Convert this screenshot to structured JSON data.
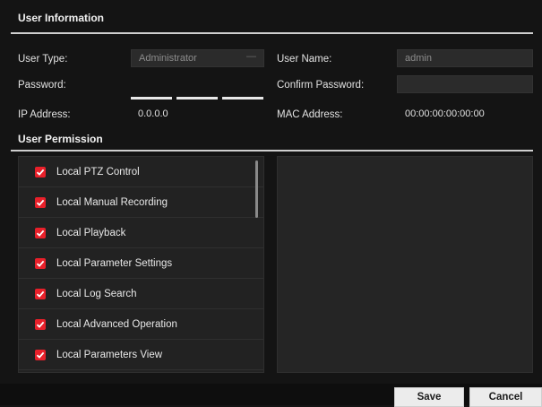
{
  "user_information": {
    "title": "User Information",
    "user_type": {
      "label": "User Type:",
      "value": "Administrator"
    },
    "user_name": {
      "label": "User Name:",
      "value": "admin"
    },
    "password": {
      "label": "Password:"
    },
    "confirm_password": {
      "label": "Confirm Password:"
    },
    "ip_address": {
      "label": "IP Address:",
      "value": "0.0.0.0"
    },
    "mac_address": {
      "label": "MAC Address:",
      "value": "00:00:00:00:00:00"
    }
  },
  "user_permission": {
    "title": "User Permission",
    "items": [
      {
        "label": "Local PTZ Control",
        "checked": true
      },
      {
        "label": "Local Manual Recording",
        "checked": true
      },
      {
        "label": "Local Playback",
        "checked": true
      },
      {
        "label": "Local Parameter Settings",
        "checked": true
      },
      {
        "label": "Local Log Search",
        "checked": true
      },
      {
        "label": "Local Advanced Operation",
        "checked": true
      },
      {
        "label": "Local Parameters View",
        "checked": true
      }
    ]
  },
  "footer": {
    "save_label": "Save",
    "cancel_label": "Cancel"
  },
  "colors": {
    "checkbox_accent": "#e8202a",
    "background": "#141414"
  }
}
